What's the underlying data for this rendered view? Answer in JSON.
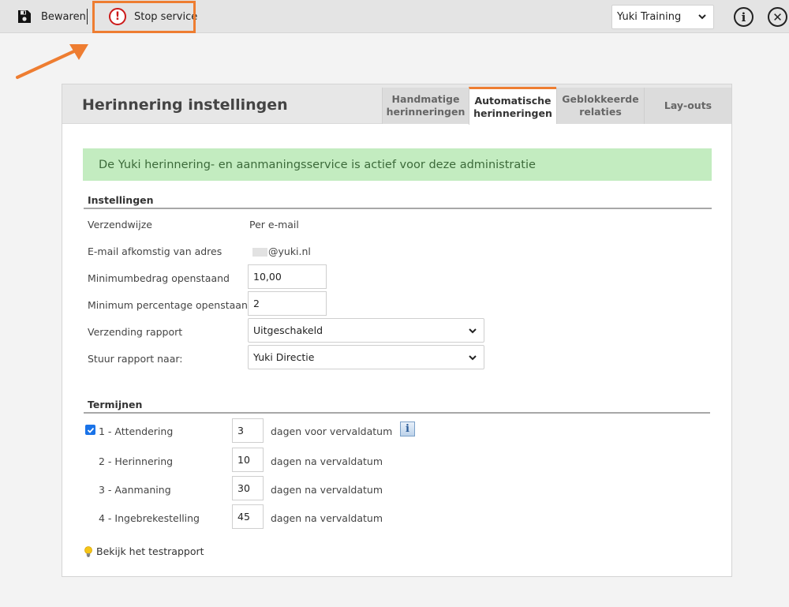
{
  "toolbar": {
    "save_label": "Bewaren",
    "stop_label": "Stop service",
    "admin_selected": "Yuki Training"
  },
  "panel": {
    "title": "Herinnering instellingen",
    "tabs": [
      {
        "line1": "Handmatige",
        "line2": "herinneringen"
      },
      {
        "line1": "Automatische",
        "line2": "herinneringen"
      },
      {
        "line1": "Geblokkeerde",
        "line2": "relaties"
      },
      {
        "line1": "Lay-outs",
        "line2": ""
      }
    ],
    "active_tab": 1,
    "banner": "De Yuki herinnering- en aanmaningsservice is actief voor deze administratie"
  },
  "settings": {
    "heading": "Instellingen",
    "verzendwijze_label": "Verzendwijze",
    "verzendwijze_value": "Per e-mail",
    "email_label": "E-mail afkomstig van adres",
    "email_value": "@yuki.nl",
    "min_amount_label": "Minimumbedrag openstaand",
    "min_amount_value": "10,00",
    "min_percentage_label": "Minimum percentage openstaand",
    "min_percentage_value": "2",
    "report_label": "Verzending rapport",
    "report_value": "Uitgeschakeld",
    "send_to_label": "Stuur rapport naar:",
    "send_to_value": "Yuki Directie"
  },
  "terms": {
    "heading": "Termijnen",
    "rows": [
      {
        "label": "1 - Attendering",
        "days": "3",
        "suffix": "dagen voor vervaldatum",
        "checked": true
      },
      {
        "label": "2 - Herinnering",
        "days": "10",
        "suffix": "dagen na vervaldatum"
      },
      {
        "label": "3 - Aanmaning",
        "days": "30",
        "suffix": "dagen na vervaldatum"
      },
      {
        "label": "4 - Ingebrekestelling",
        "days": "45",
        "suffix": "dagen na vervaldatum"
      }
    ]
  },
  "testreport_link": "Bekijk het testrapport",
  "colors": {
    "accent": "#ee7d31",
    "banner_bg": "#c3ecc0",
    "stop_red": "#cc1a1a"
  }
}
